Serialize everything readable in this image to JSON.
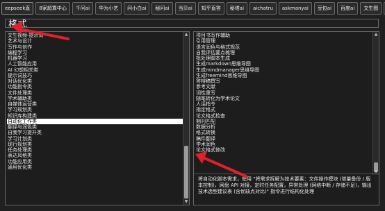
{
  "tabs": [
    "eepseek直 ",
    "8家超算中心",
    "千问ai",
    "华为小艺",
    "问小白ai",
    "秘问ai",
    "当贝ai",
    "知乎直答",
    "秘塔ai",
    "aichatru",
    "askmanyai",
    "豆包ai",
    "百度ai",
    "文生图",
    "+"
  ],
  "search": {
    "value": "格式"
  },
  "left_list": {
    "items": [
      "文生视频-提示词",
      "艺术与设计",
      "写作与创作",
      "编程学习",
      "机器学习",
      "人工智能应用",
      "AI 幻想相关类",
      "提示词技巧",
      "对话优化类",
      "功能指令类",
      "文件处理类",
      "学术辅助类",
      "自媒体运营类",
      "学习规划类",
      "知识库构建类",
      "自动化工作类",
      "翻译与润色类",
      "自我学习提升类",
      "学习计划类",
      "现行规划类",
      "任务处理类",
      "表达风格类",
      "功能应用类",
      "通用优化类"
    ],
    "selected_index": 15
  },
  "right_list": {
    "items": [
      "项目书写作辅助",
      "引用管理",
      "语言润色与格式规范",
      "自我评估要点梳理",
      "批处理脚本生成",
      "生成markdown思维导图",
      "生成mindmanager思维导图",
      "生成freemind思维导图",
      "答辩稿撰写",
      "参考文献",
      "词性重写",
      "随笔转化为学术论文",
      "人话指令",
      "指定格式",
      "论文格式检查",
      "期刊匹配",
      "数据分析",
      "格式转换",
      "稿件翻译",
      "学术润色",
      "论文格式修改"
    ],
    "selected_index": -1
  },
  "description": {
    "text": "将自动化脚本需求，使用 \"将需求拆解为技术要素：文件操作模块 (增量备份 / 版本控制)，网盘 API 对接，定时任务配置，异常处理 (网络中断 / 存储不足)，输出技术选型建议表 (含优缺点对比)\" 指令进行结构化处理"
  },
  "annotation": {
    "arrow_color": "#e0202a"
  }
}
